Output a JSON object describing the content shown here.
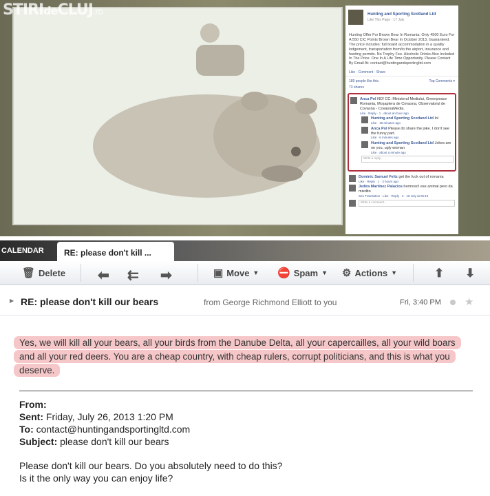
{
  "watermark": {
    "main": "STIRI",
    "mid": "de",
    "end": "CLUJ",
    "suffix": ".ro"
  },
  "facebook": {
    "page_name": "Hunting and Sporting Scotland Ltd",
    "page_sub": "Like This Page · 17 July",
    "post_text": "Hunting Offer For Brown Bear In Romania: Only 4500 Euro For A 550 CIC Points Brown Bear In October 2013, Guaranteed. The price includes: full board accommodation in a quality lodgement, transportation from/to the airport, insurance and hunting permits. No Trophy Fee. Alcoholic Drinks Also Included In The Price. One In A Life Time Opportunity. Please Contact By Email At: contact@huntingandsportingltd.com",
    "post_actions": "Like · Comment · Share",
    "likes": "189 people like this.",
    "top_comments": "Top Comments ▾",
    "shares": "73 shares",
    "comments": [
      {
        "name": "Anca Pol",
        "text": "NO! CC: Ministerul Mediului, Greenpeace Romania, Moşaptera de Covasna, Observatorul de Covasna - CovasnaMedia.",
        "foot": "Like · Reply · 1 · about an hour ago"
      },
      {
        "name": "Hunting and Sporting Scotland Ltd",
        "text": "lol",
        "foot": "Like · 15 minutes ago",
        "reply": true
      },
      {
        "name": "Anca Pol",
        "text": "Please do share the joke. I don't see the funny part.",
        "foot": "Like · 6 minutes ago",
        "reply": true
      },
      {
        "name": "Hunting and Sporting Scotland Ltd",
        "text": "Jokes are on you, ugly woman",
        "foot": "Like · about a minute ago",
        "reply": true
      }
    ],
    "write_reply": "Write a reply...",
    "more_comments": [
      {
        "name": "Dominic Samuel Feltz",
        "text": "get the fuck out of romania",
        "foot": "Like · Reply · 1 · 3 hours ago"
      },
      {
        "name": "Jedira Martinez Palacios",
        "text": "hermoso! ese animal pero da miedito",
        "foot": "See Translation · Like · Reply · 2 · 18 July at 06:19"
      }
    ],
    "write_comment": "Write a comment..."
  },
  "mail": {
    "calendar_label": "CALENDAR",
    "tab_title": "RE: please don't kill ...",
    "toolbar": {
      "delete": "Delete",
      "move": "Move",
      "spam": "Spam",
      "actions": "Actions"
    },
    "header": {
      "subject": "RE: please don't kill our bears",
      "from_line": "from George Richmond Elliott to you",
      "date": "Fri, 3:40 PM"
    },
    "reply_text": "Yes, we will kill all your bears, all your birds from the Danube Delta, all your capercailles, all your wild boars and all your red deers. You are a cheap country, with cheap rulers, corrupt politicians, and this is what you deserve.",
    "quoted": {
      "from_label": "From:",
      "sent_label": "Sent:",
      "sent_value": "Friday, July 26, 2013 1:20 PM",
      "to_label": "To:",
      "to_value": "contact@huntingandsportingltd.com",
      "subject_label": "Subject:",
      "subject_value": "please don't kill our bears",
      "message_line1": "Please don't kill our bears. Do you absolutely need to do this?",
      "message_line2": "Is it the only way you can enjoy life?"
    }
  },
  "colors": {
    "highlight": "#f6c7c9",
    "fb_link": "#3b5998",
    "fb_box_border": "#b03040"
  }
}
